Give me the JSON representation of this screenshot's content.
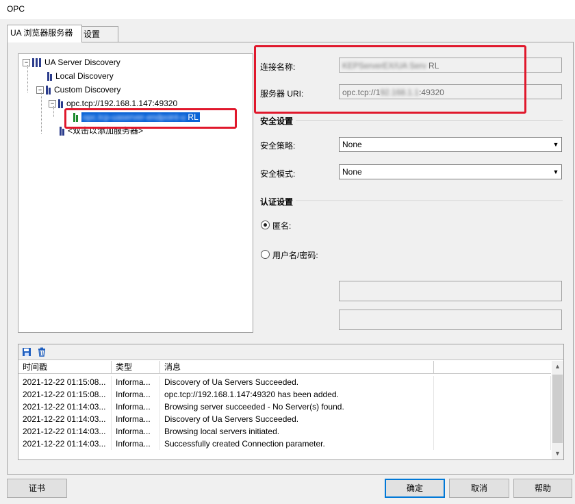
{
  "window": {
    "title": "OPC"
  },
  "tabs": [
    {
      "label": "UA 浏览器服务器"
    },
    {
      "label": "设置"
    }
  ],
  "tree": {
    "root": "UA Server Discovery",
    "local": "Local Discovery",
    "custom": "Custom Discovery",
    "endpoint": "opc.tcp://192.168.1.147:49320",
    "selected_suffix": "RL",
    "add_server": "<双击以添加服务器>"
  },
  "connection": {
    "name_label": "连接名称:",
    "name_value_suffix": "RL",
    "uri_label": "服务器 URI:",
    "uri_prefix": "opc.tcp://1",
    "uri_suffix": ":49320"
  },
  "security": {
    "section_title": "安全设置",
    "policy_label": "安全策略:",
    "policy_value": "None",
    "mode_label": "安全模式:",
    "mode_value": "None"
  },
  "auth": {
    "section_title": "认证设置",
    "anonymous_label": "匿名:",
    "userpass_label": "用户名/密码:"
  },
  "log": {
    "columns": [
      "时间戳",
      "类型",
      "消息"
    ],
    "rows": [
      [
        "2021-12-22 01:15:08...",
        "Informa...",
        "Discovery of Ua Servers Succeeded."
      ],
      [
        "2021-12-22 01:15:08...",
        "Informa...",
        "opc.tcp://192.168.1.147:49320 has been added."
      ],
      [
        "2021-12-22 01:14:03...",
        "Informa...",
        "Browsing server succeeded - No Server(s) found."
      ],
      [
        "2021-12-22 01:14:03...",
        "Informa...",
        "Discovery of Ua Servers Succeeded."
      ],
      [
        "2021-12-22 01:14:03...",
        "Informa...",
        "Browsing local servers initiated."
      ],
      [
        "2021-12-22 01:14:03...",
        "Informa...",
        "Successfully created Connection parameter."
      ]
    ]
  },
  "buttons": {
    "cert": "证书",
    "ok": "确定",
    "cancel": "取消",
    "help": "帮助"
  },
  "colors": {
    "highlight": "#e0182c",
    "selection": "#0a63d6",
    "tree_icon": "#2b3c8c",
    "tree_icon_green": "#1e8a2e",
    "toolbar_icon": "#1f5fbf"
  }
}
